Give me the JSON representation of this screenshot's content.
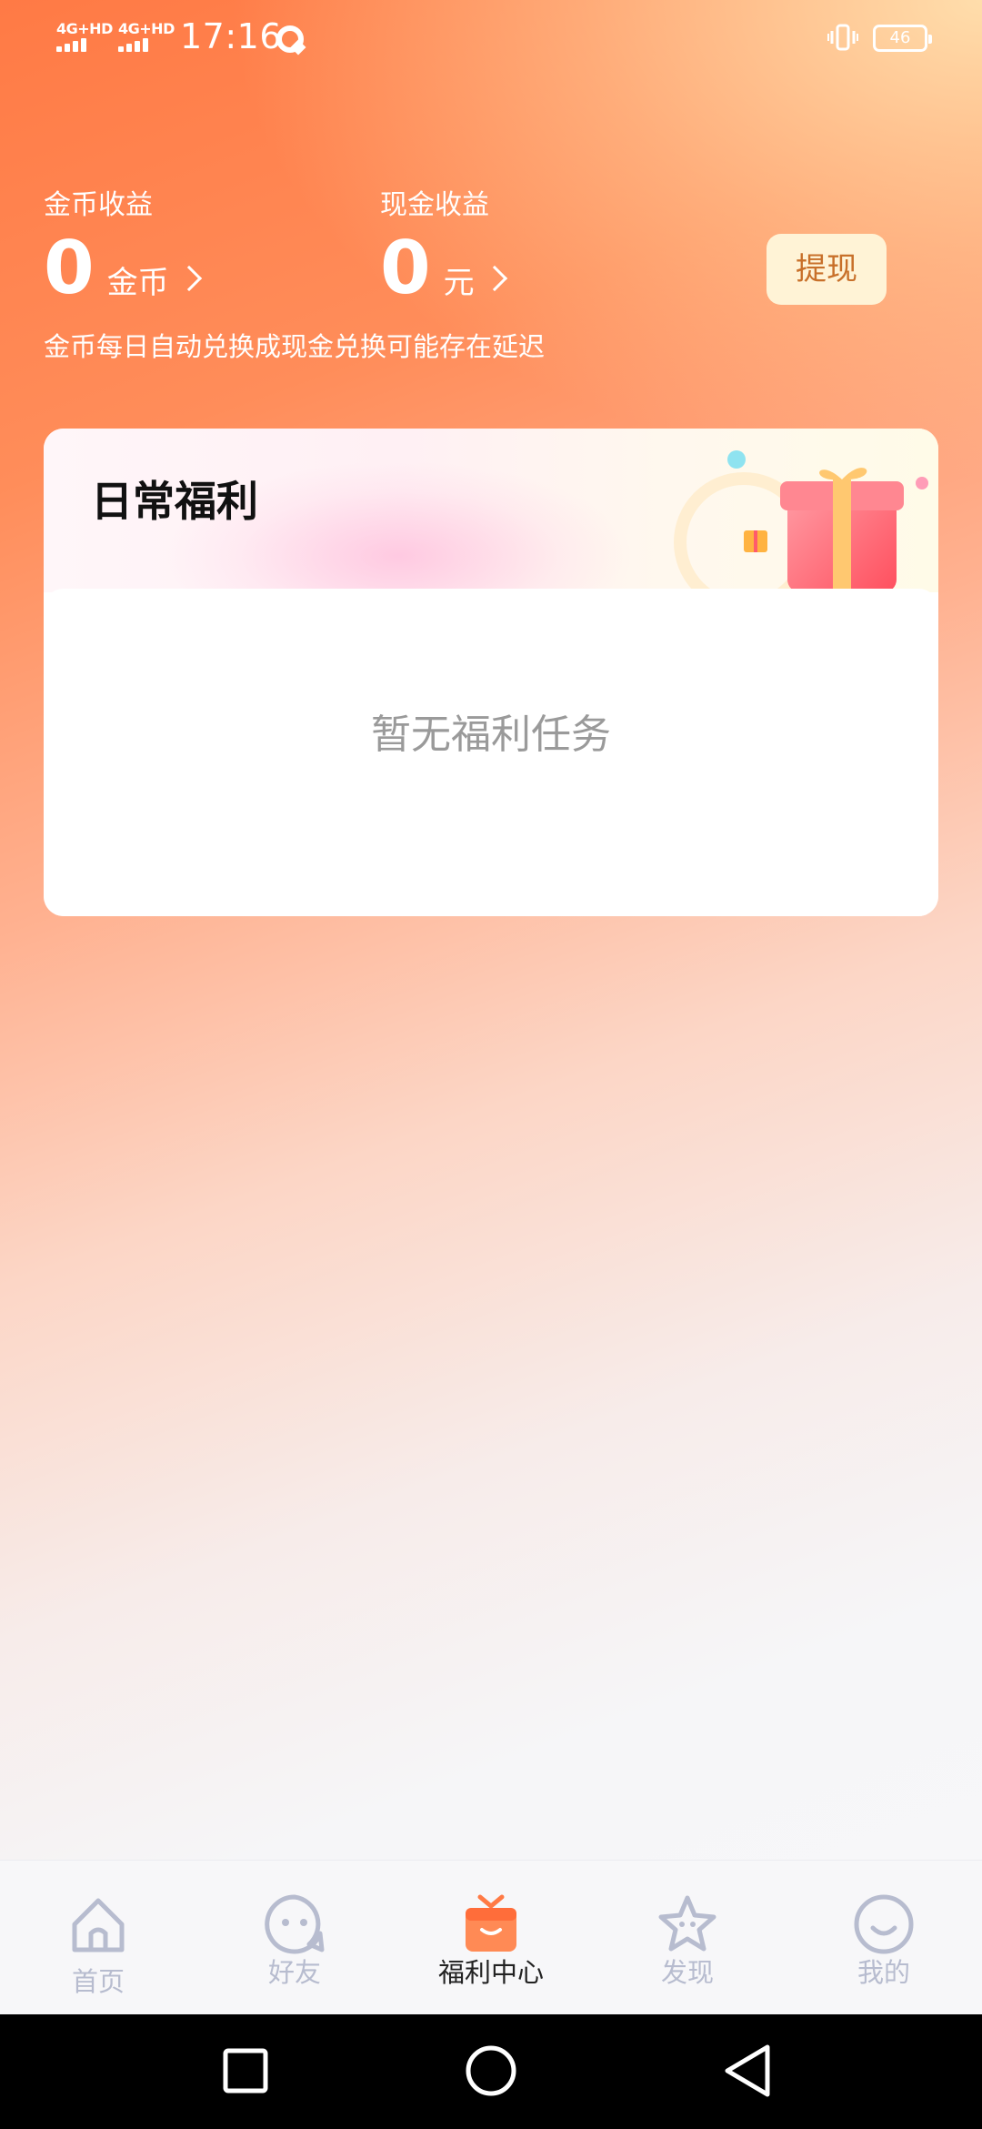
{
  "status_bar": {
    "signal_1": "4G+HD",
    "signal_2": "4G+HD",
    "time": "17:16",
    "battery": "46"
  },
  "earnings": {
    "coin_label": "金币收益",
    "coin_value": "0",
    "coin_unit": "金币",
    "cash_label": "现金收益",
    "cash_value": "0",
    "cash_unit": "元",
    "withdraw_label": "提现",
    "note": "金币每日自动兑换成现金兑换可能存在延迟"
  },
  "daily_card": {
    "title": "日常福利",
    "empty_text": "暂无福利任务"
  },
  "bottom_nav": {
    "items": [
      {
        "label": "首页",
        "icon": "home-icon"
      },
      {
        "label": "好友",
        "icon": "friends-icon"
      },
      {
        "label": "福利中心",
        "icon": "gift-box-icon",
        "active": true
      },
      {
        "label": "发现",
        "icon": "star-icon"
      },
      {
        "label": "我的",
        "icon": "smile-icon"
      }
    ]
  },
  "colors": {
    "accent_orange": "#ff7a45",
    "nav_inactive": "#b7bccf",
    "withdraw_text": "#c8702a"
  }
}
